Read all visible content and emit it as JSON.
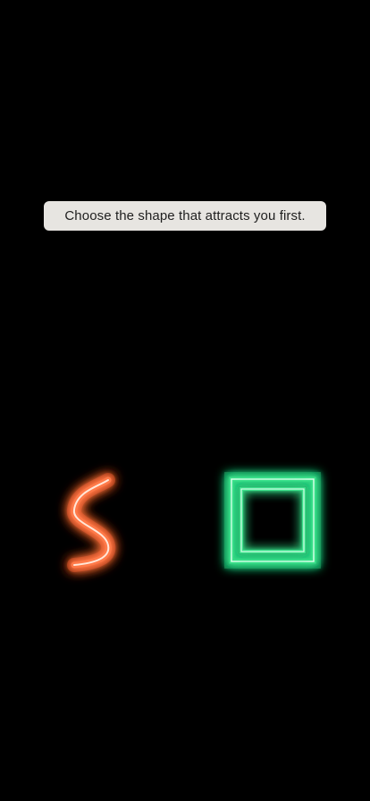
{
  "prompt": {
    "text": "Choose the shape that attracts you first."
  },
  "options": [
    {
      "id": "s-curve",
      "icon": "neon-s-curve-icon",
      "color": "#ff7a4a"
    },
    {
      "id": "square",
      "icon": "neon-square-icon",
      "color": "#3be08a"
    }
  ],
  "colors": {
    "background": "#000000",
    "banner": "#e7e5e1",
    "banner_text": "#1f1f1f"
  }
}
